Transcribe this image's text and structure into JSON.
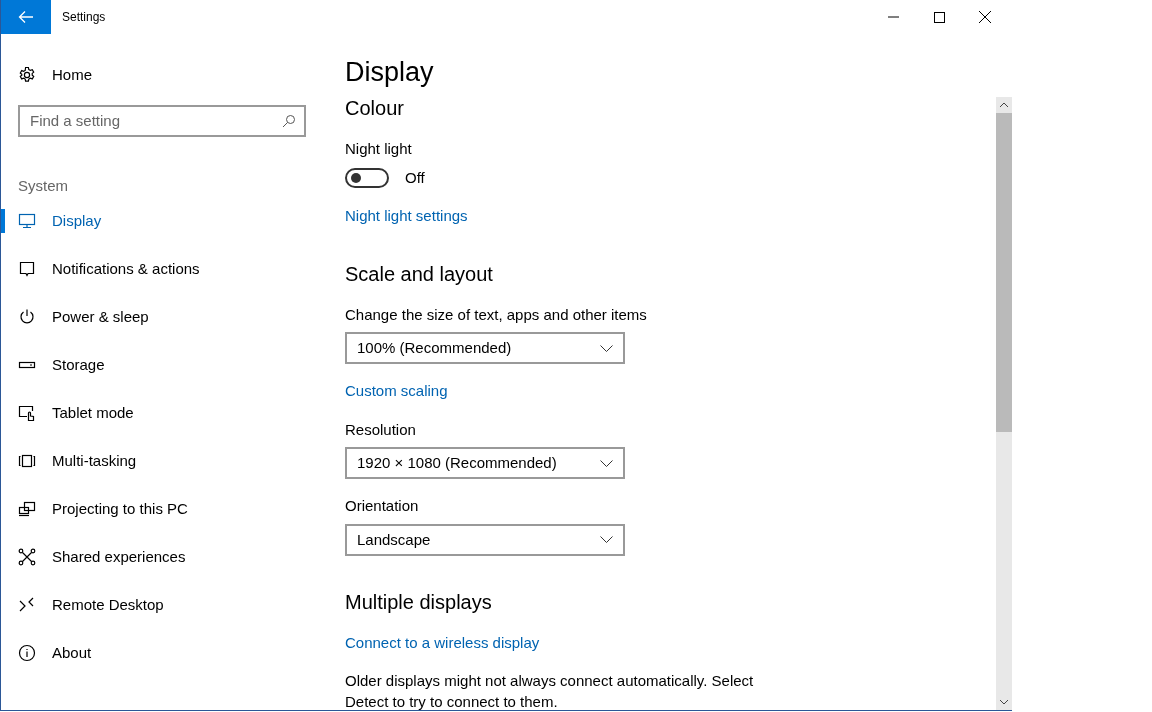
{
  "window": {
    "title": "Settings"
  },
  "sidebar": {
    "home": "Home",
    "search": {
      "placeholder": "Find a setting"
    },
    "section": "System",
    "items": [
      {
        "label": "Display",
        "selected": true
      },
      {
        "label": "Notifications & actions",
        "selected": false
      },
      {
        "label": "Power & sleep",
        "selected": false
      },
      {
        "label": "Storage",
        "selected": false
      },
      {
        "label": "Tablet mode",
        "selected": false
      },
      {
        "label": "Multi-tasking",
        "selected": false
      },
      {
        "label": "Projecting to this PC",
        "selected": false
      },
      {
        "label": "Shared experiences",
        "selected": false
      },
      {
        "label": "Remote Desktop",
        "selected": false
      },
      {
        "label": "About",
        "selected": false
      }
    ]
  },
  "page": {
    "title": "Display",
    "sections": [
      {
        "heading": "Colour",
        "items": [
          {
            "kind": "toggle",
            "label": "Night light",
            "on": false,
            "state_text": "Off"
          },
          {
            "kind": "link",
            "text": "Night light settings"
          }
        ]
      },
      {
        "heading": "Scale and layout",
        "items": [
          {
            "kind": "dropdown",
            "label": "Change the size of text, apps and other items",
            "value": "100% (Recommended)"
          },
          {
            "kind": "link",
            "text": "Custom scaling"
          },
          {
            "kind": "dropdown",
            "label": "Resolution",
            "value": "1920 × 1080 (Recommended)"
          },
          {
            "kind": "dropdown",
            "label": "Orientation",
            "value": "Landscape"
          }
        ]
      },
      {
        "heading": "Multiple displays",
        "items": [
          {
            "kind": "link",
            "text": "Connect to a wireless display"
          },
          {
            "kind": "text",
            "text": "Older displays might not always connect automatically. Select Detect to try to connect to them."
          }
        ]
      }
    ]
  }
}
